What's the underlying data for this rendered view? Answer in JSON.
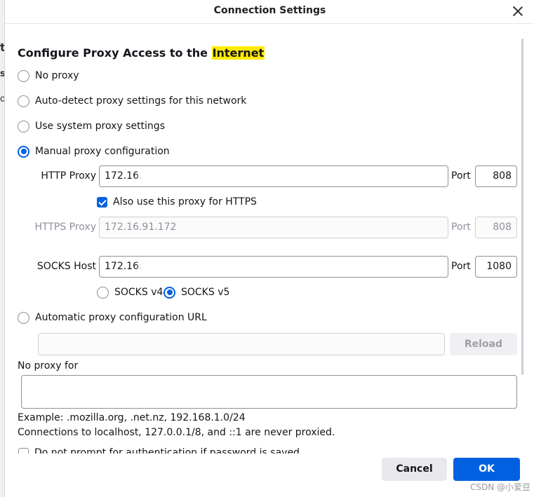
{
  "window": {
    "title": "Connection Settings"
  },
  "background": {
    "snippets": [
      "t",
      "s",
      "o"
    ]
  },
  "heading": {
    "prefix": "Configure Proxy Access to the ",
    "highlight": "Internet"
  },
  "options": {
    "no_proxy": "No proxy",
    "auto_detect": "Auto-detect proxy settings for this network",
    "system": "Use system proxy settings",
    "manual": "Manual proxy configuration",
    "auto_url": "Automatic proxy configuration URL",
    "selected": "manual"
  },
  "http": {
    "label": "HTTP Proxy",
    "value": "172.16.",
    "port_label": "Port",
    "port": "808"
  },
  "also_https": {
    "label": "Also use this proxy for HTTPS",
    "checked": true
  },
  "https": {
    "label": "HTTPS Proxy",
    "value": "172.16.91.172",
    "port_label": "Port",
    "port": "808"
  },
  "socks": {
    "label": "SOCKS Host",
    "value": "172.16.",
    "port_label": "Port",
    "port": "1080",
    "v4": "SOCKS v4",
    "v5": "SOCKS v5",
    "selected": "v5"
  },
  "auto_url": {
    "value": "",
    "reload_label": "Reload"
  },
  "no_proxy_for": {
    "label": "No proxy for",
    "value": ""
  },
  "notes": {
    "example": "Example: .mozilla.org, .net.nz, 192.168.1.0/24",
    "localhost": "Connections to localhost, 127.0.0.1/8, and ::1 are never proxied."
  },
  "auth_prompt": {
    "label": "Do not prompt for authentication if password is saved",
    "checked": false
  },
  "buttons": {
    "cancel": "Cancel",
    "ok": "OK"
  },
  "watermark": "CSDN @小爱豆",
  "colors": {
    "accent": "#0061e0",
    "highlight": "#ffeb00"
  }
}
